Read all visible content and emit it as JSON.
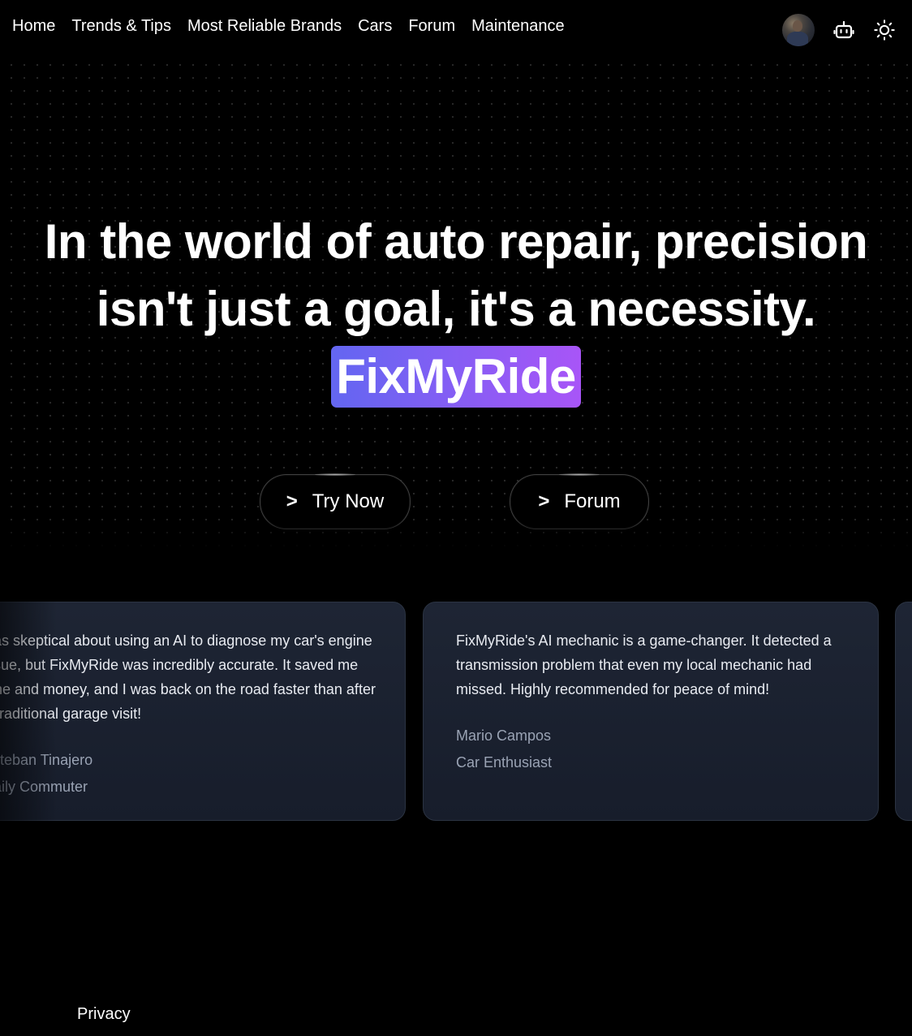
{
  "nav": {
    "links": [
      "Home",
      "Trends & Tips",
      "Most Reliable Brands",
      "Cars",
      "Forum",
      "Maintenance"
    ],
    "icons": {
      "avatar": "user-avatar",
      "assistant": "robot-icon",
      "theme": "sun-icon"
    }
  },
  "hero": {
    "line1": "In the world of auto repair, precision",
    "line2": "isn't just a goal, it's a necessity.",
    "brand": "FixMyRide",
    "brand_gradient": [
      "#6366f1",
      "#a855f7"
    ],
    "buttons": {
      "chevron": ">",
      "try_now": "Try Now",
      "forum": "Forum"
    }
  },
  "testimonials": [
    {
      "quote": "was skeptical about using an AI to diagnose my car's engine issue, but FixMyRide was incredibly accurate. It saved me time and money, and I was back on the road faster than after a traditional garage visit!",
      "name": "Esteban Tinajero",
      "role": "Daily Commuter"
    },
    {
      "quote": "FixMyRide's AI mechanic is a game-changer. It detected a transmission problem that even my local mechanic had missed. Highly recommended for peace of mind!",
      "name": "Mario Campos",
      "role": "Car Enthusiast"
    }
  ],
  "footer": {
    "privacy": "Privacy"
  },
  "colors": {
    "background": "#000000",
    "card_bg": "#1b2130",
    "card_border": "#2b3342",
    "muted_text": "#9aa3b4"
  }
}
